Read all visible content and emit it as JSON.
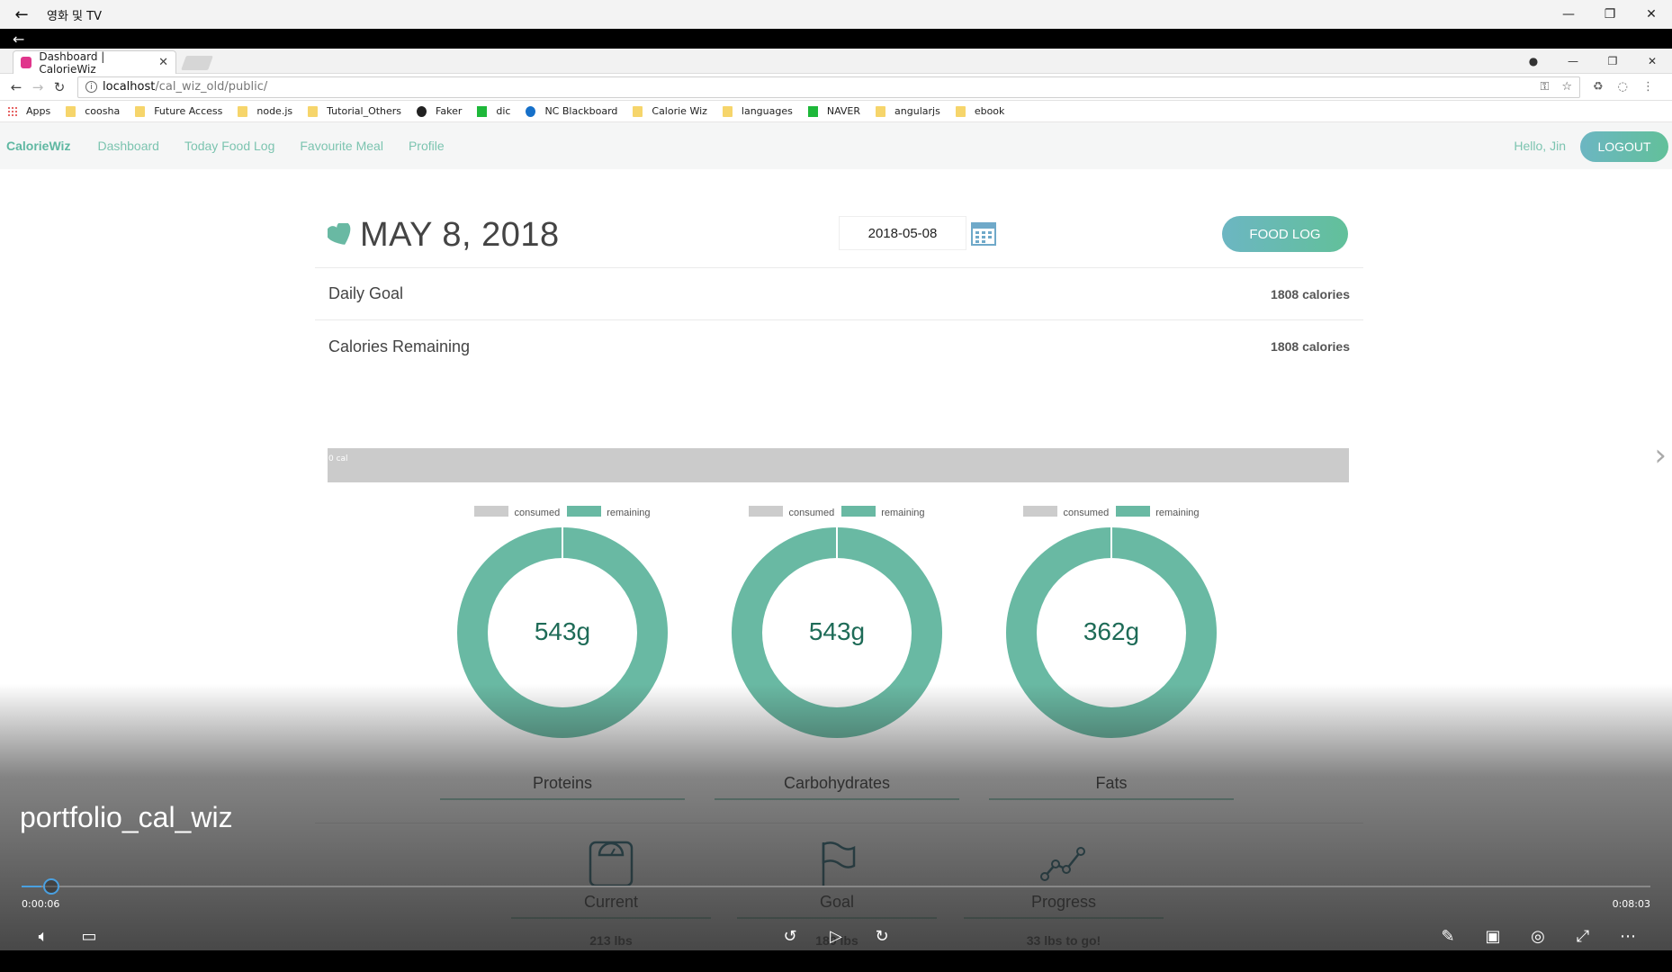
{
  "player": {
    "title": "영화 및 TV",
    "video_title": "portfolio_cal_wiz",
    "time_current": "0:00:06",
    "time_total": "0:08:03",
    "progress_fraction": 0.012
  },
  "browser": {
    "tab_title": "Dashboard | CalorieWiz",
    "url_host": "localhost",
    "url_path": "/cal_wiz_old/public/",
    "bookmarks": [
      "Apps",
      "coosha",
      "Future Access",
      "node.js",
      "Tutorial_Others",
      "Faker",
      "dic",
      "NC Blackboard",
      "Calorie Wiz",
      "languages",
      "NAVER",
      "angularjs",
      "ebook"
    ]
  },
  "nav": {
    "brand": "CalorieWiz",
    "links": [
      "Dashboard",
      "Today Food Log",
      "Favourite Meal",
      "Profile"
    ],
    "greeting": "Hello, Jin",
    "logout": "LOGOUT"
  },
  "dashboard": {
    "date_title": "MAY 8, 2018",
    "date_value": "2018-05-08",
    "food_log_button": "FOOD LOG",
    "daily_goal_label": "Daily Goal",
    "daily_goal_value": "1808 calories",
    "remaining_label": "Calories Remaining",
    "remaining_value": "1808 calories",
    "calorie_bar_label": "0 cal",
    "legend_consumed": "consumed",
    "legend_remaining": "remaining",
    "macros": [
      {
        "name": "Proteins",
        "value": "543g"
      },
      {
        "name": "Carbohydrates",
        "value": "543g"
      },
      {
        "name": "Fats",
        "value": "362g"
      }
    ],
    "weight": [
      {
        "label": "Current",
        "value": "213 lbs"
      },
      {
        "label": "Goal",
        "value": "180 lbs"
      },
      {
        "label": "Progress",
        "value": "33 lbs to go!"
      }
    ]
  },
  "colors": {
    "accent": "#69b9a3",
    "consumed": "#cccccc",
    "value_text": "#1e6b57"
  }
}
